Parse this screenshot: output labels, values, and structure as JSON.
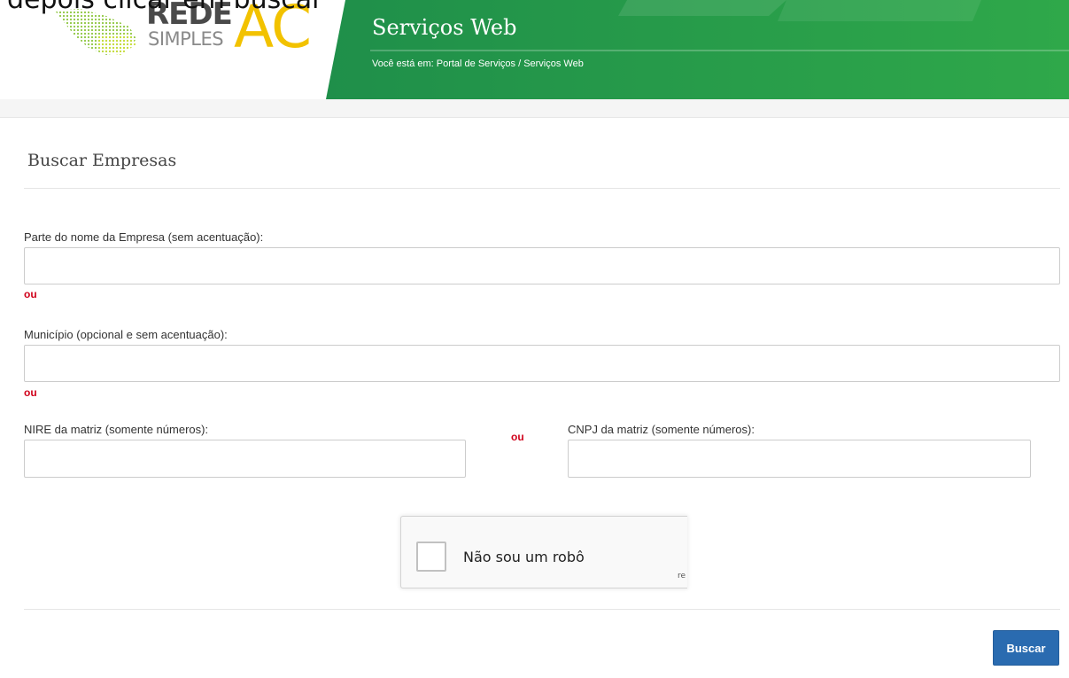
{
  "overlay": {
    "text": "depois clicar em buscar"
  },
  "header": {
    "logo_rede": "REDE",
    "logo_simples": "SIMPLES",
    "logo_ac": "AC",
    "title": "Serviços Web",
    "breadcrumb": "Você está em: Portal de Serviços / Serviços Web"
  },
  "form": {
    "title": "Buscar Empresas",
    "nome_label": "Parte do nome da Empresa (sem acentuação):",
    "nome_value": "",
    "municipio_label": "Município (opcional e sem acentuação):",
    "municipio_value": "",
    "nire_label": "NIRE da matriz (somente números):",
    "nire_value": "",
    "cnpj_label": "CNPJ da matriz (somente números):",
    "cnpj_value": "",
    "ou": "ou"
  },
  "recaptcha": {
    "label": "Não sou um robô",
    "brand": "re"
  },
  "actions": {
    "buscar_label": "Buscar"
  },
  "colors": {
    "green": "#2b9a48",
    "green_light": "#3bb457",
    "yellow": "#f2c200",
    "button": "#2a6bb0",
    "ou": "#d0021b"
  }
}
